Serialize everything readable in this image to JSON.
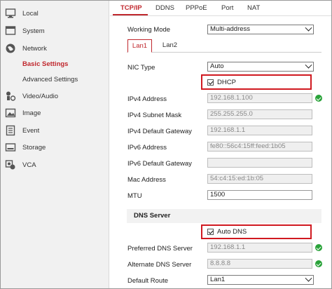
{
  "sidebar": {
    "items": [
      {
        "label": "Local",
        "icon": "monitor-icon"
      },
      {
        "label": "System",
        "icon": "system-icon"
      },
      {
        "label": "Network",
        "icon": "globe-icon"
      },
      {
        "label": "Video/Audio",
        "icon": "video-audio-icon"
      },
      {
        "label": "Image",
        "icon": "image-icon"
      },
      {
        "label": "Event",
        "icon": "event-icon"
      },
      {
        "label": "Storage",
        "icon": "storage-icon"
      },
      {
        "label": "VCA",
        "icon": "vca-icon"
      }
    ],
    "subitems": [
      {
        "label": "Basic Settings",
        "active": true
      },
      {
        "label": "Advanced Settings",
        "active": false
      }
    ]
  },
  "tabs": [
    "TCP/IP",
    "DDNS",
    "PPPoE",
    "Port",
    "NAT"
  ],
  "lan_tabs": [
    "Lan1",
    "Lan2"
  ],
  "form": {
    "working_mode_label": "Working Mode",
    "working_mode_value": "Multi-address",
    "nic_type_label": "NIC Type",
    "nic_type_value": "Auto",
    "dhcp_label": "DHCP",
    "ipv4_address_label": "IPv4 Address",
    "ipv4_address_value": "192.168.1.100",
    "ipv4_mask_label": "IPv4 Subnet Mask",
    "ipv4_mask_value": "255.255.255.0",
    "ipv4_gateway_label": "IPv4 Default Gateway",
    "ipv4_gateway_value": "192.168.1.1",
    "ipv6_address_label": "IPv6 Address",
    "ipv6_address_value": "fe80::56c4:15ff:feed:1b05",
    "ipv6_gateway_label": "IPv6 Default Gateway",
    "ipv6_gateway_value": "",
    "mac_label": "Mac Address",
    "mac_value": "54:c4:15:ed:1b:05",
    "mtu_label": "MTU",
    "mtu_value": "1500",
    "dns_section": "DNS Server",
    "auto_dns_label": "Auto DNS",
    "preferred_dns_label": "Preferred DNS Server",
    "preferred_dns_value": "192.168.1.1",
    "alternate_dns_label": "Alternate DNS Server",
    "alternate_dns_value": "8.8.8.8",
    "default_route_label": "Default Route",
    "default_route_value": "Lan1"
  },
  "colors": {
    "accent": "#c0272d",
    "highlight": "#d01920",
    "ok": "#2aa33a"
  }
}
